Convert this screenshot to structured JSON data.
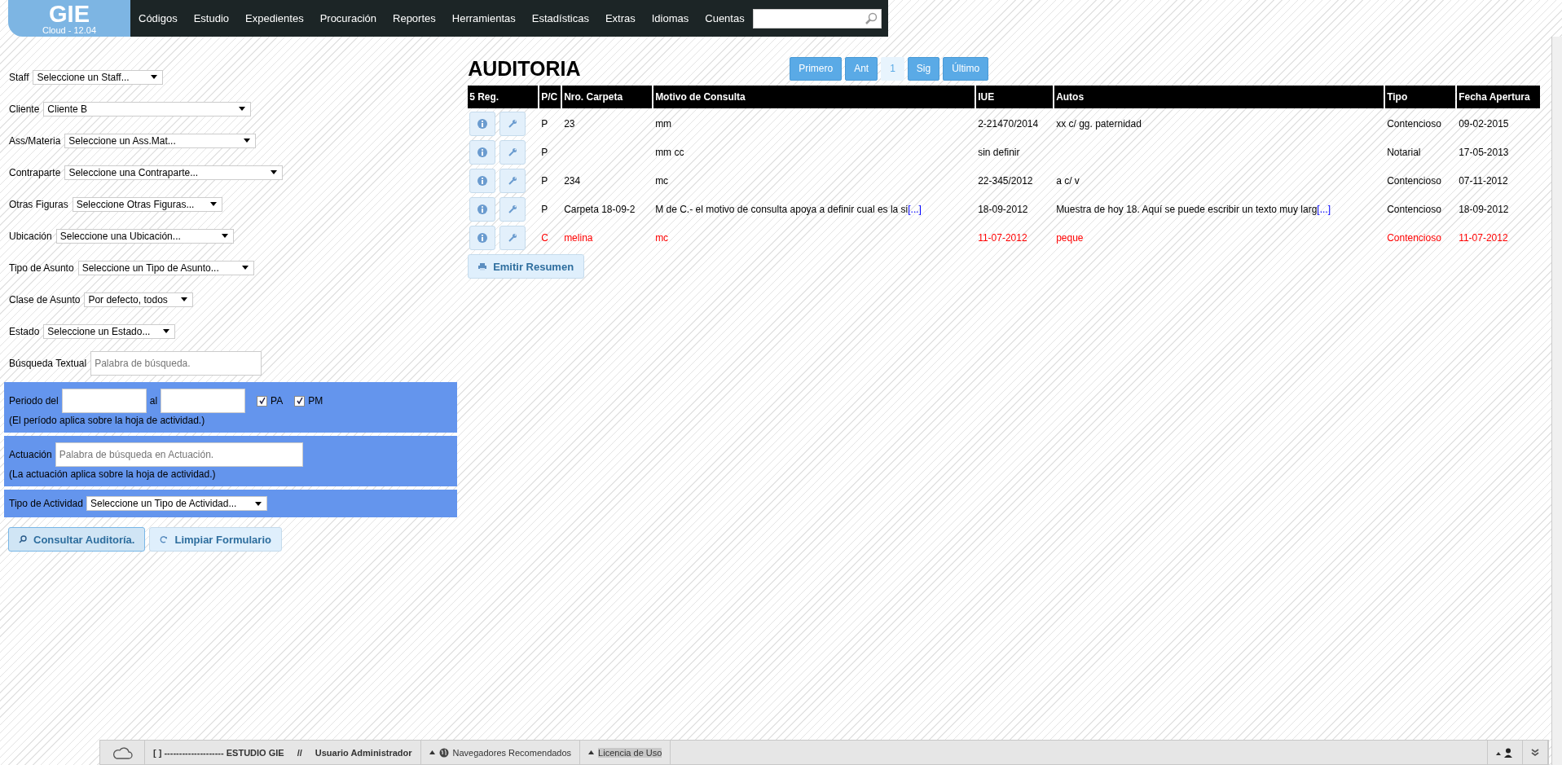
{
  "logo": {
    "name": "GIE",
    "version": "Cloud  - 12.04"
  },
  "menu": [
    {
      "label": "Códigos"
    },
    {
      "label": "Estudio"
    },
    {
      "label": "Expedientes"
    },
    {
      "label": "Procuración"
    },
    {
      "label": "Reportes"
    },
    {
      "label": "Herramientas"
    },
    {
      "label": "Estadísticas"
    },
    {
      "label": "Extras"
    },
    {
      "label": "Idiomas"
    },
    {
      "label": "Cuentas"
    }
  ],
  "filters": [
    {
      "label": "Staff",
      "kind": "select",
      "value": "Seleccione un Staff..."
    },
    {
      "label": "Cliente",
      "kind": "select",
      "value": "Cliente B"
    },
    {
      "label": "Ass/Materia",
      "kind": "select",
      "value": "Seleccione un Ass.Mat..."
    },
    {
      "label": "Contraparte",
      "kind": "select",
      "value": "Seleccione una Contraparte..."
    },
    {
      "label": "Otras Figuras",
      "kind": "select",
      "value": "Seleccione Otras Figuras..."
    },
    {
      "label": "Ubicación",
      "kind": "select",
      "value": "Seleccione una Ubicación..."
    },
    {
      "label": "Tipo de Asunto",
      "kind": "select",
      "value": "Seleccione un Tipo de Asunto..."
    },
    {
      "label": "Clase de Asunto",
      "kind": "select",
      "value": "Por defecto, todos"
    },
    {
      "label": "Estado",
      "kind": "select",
      "value": "Seleccione un Estado..."
    },
    {
      "label": "Búsqueda Textual",
      "kind": "text",
      "placeholder": "Palabra de búsqueda."
    }
  ],
  "period": {
    "label": "Periodo del",
    "to_label": "al",
    "checks": [
      {
        "label": "PA",
        "checked": true
      },
      {
        "label": "PM",
        "checked": true
      }
    ],
    "note": "(El período aplica sobre la hoja de actividad.)"
  },
  "actuacion": {
    "label": "Actuación",
    "placeholder": "Palabra de búsqueda en Actuación.",
    "note": "(La actuación aplica sobre la hoja de actividad.)"
  },
  "activity_type": {
    "label": "Tipo de Actividad",
    "value": "Seleccione un Tipo de Actividad..."
  },
  "actions": [
    {
      "label": "Consultar Auditoría.",
      "kind": "search"
    },
    {
      "label": "Limpiar Formulario",
      "kind": "reset"
    }
  ],
  "title": "AUDITORIA",
  "pager": [
    {
      "label": "Primero",
      "selected": false
    },
    {
      "label": "Ant",
      "selected": false
    },
    {
      "label": "1",
      "selected": true
    },
    {
      "label": "Sig",
      "selected": false
    },
    {
      "label": "Último",
      "selected": false
    }
  ],
  "table": {
    "columns": [
      "5 Reg.",
      "P/C",
      "Nro. Carpeta",
      "Motivo de Consulta",
      "IUE",
      "Autos",
      "Tipo",
      "Fecha Apertura"
    ],
    "rows": [
      {
        "alert": false,
        "pc": "P",
        "carpeta": "23",
        "motivo": "mm",
        "iue": "2-21470/2014",
        "autos": "xx c/ gg. paternidad",
        "tipo": "Contencioso",
        "fecha": "09-02-2015"
      },
      {
        "alert": false,
        "pc": "P",
        "motivo": "mm cc",
        "iue": "sin definir",
        "tipo": "Notarial",
        "fecha": "17-05-2013"
      },
      {
        "alert": false,
        "pc": "P",
        "carpeta": "234",
        "motivo": "mc",
        "iue": "22-345/2012",
        "autos": "a c/ v",
        "tipo": "Contencioso",
        "fecha": "07-11-2012"
      },
      {
        "alert": false,
        "pc": "P",
        "carpeta": "Carpeta 18-09-2",
        "motivo": "M de C.- el motivo de consulta apoya a definir cual es la si",
        "motivo_more": "[...]",
        "iue": "18-09-2012",
        "autos": "Muestra de hoy 18. Aquí se puede escribir un texto muy larg",
        "autos_more": "[...]",
        "tipo": "Contencioso",
        "fecha": "18-09-2012"
      },
      {
        "alert": true,
        "pc": "C",
        "carpeta": "melina",
        "motivo": "mc",
        "iue": "11-07-2012",
        "autos": "peque",
        "tipo": "Contencioso",
        "fecha": "11-07-2012"
      }
    ]
  },
  "summary_button": "Emitir Resumen",
  "footer": {
    "brand": "[ ] -------------------- ESTUDIO GIE",
    "separator": "//",
    "user": "Usuario Administrador",
    "links": [
      {
        "label": "Navegadores Recomendados",
        "selected": false
      },
      {
        "label": "Licencia de Uso",
        "selected": true
      }
    ]
  }
}
